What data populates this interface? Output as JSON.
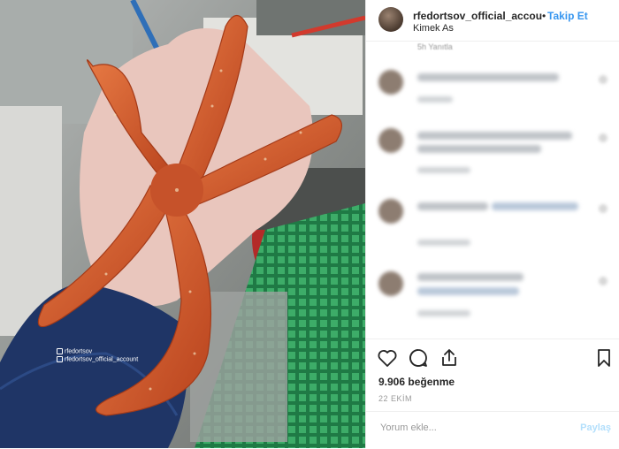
{
  "header": {
    "username": "rfedortsov_official_accou",
    "separator": "•",
    "follow_label": "Takip Et",
    "location": "Kimek As"
  },
  "comments": {
    "top_meta": "5h   Yanıtla"
  },
  "photo": {
    "watermark_line1": "rfedortsov",
    "watermark_line2": "rfedortsov_official_account"
  },
  "likes": {
    "count_text": "9.906 beğenme"
  },
  "date": "22 EKİM",
  "comment_box": {
    "placeholder": "Yorum ekle...",
    "post_label": "Paylaş"
  },
  "icons": [
    "heart-icon",
    "comment-icon",
    "share-icon",
    "bookmark-icon"
  ],
  "colors": {
    "follow": "#3897f0",
    "post_disabled": "#b2dffc",
    "starfish": "#d9582a",
    "glove": "#1f3566",
    "grate": "#2e9a5a"
  }
}
